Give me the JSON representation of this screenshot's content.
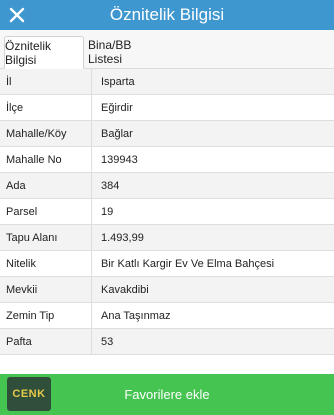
{
  "header": {
    "title": "Öznitelik Bilgisi",
    "close_icon": "close-icon"
  },
  "tabs": [
    {
      "label": "Öznitelik Bilgisi",
      "active": true
    },
    {
      "label": "Bina/BB Listesi",
      "active": false
    }
  ],
  "rows": [
    {
      "label": "İl",
      "value": "Isparta"
    },
    {
      "label": "İlçe",
      "value": "Eğirdir"
    },
    {
      "label": "Mahalle/Köy",
      "value": "Bağlar"
    },
    {
      "label": "Mahalle No",
      "value": "139943"
    },
    {
      "label": "Ada",
      "value": "384"
    },
    {
      "label": "Parsel",
      "value": "19"
    },
    {
      "label": "Tapu Alanı",
      "value": "1.493,99"
    },
    {
      "label": "Nitelik",
      "value": "Bir Katlı Kargir Ev Ve Elma Bahçesi"
    },
    {
      "label": "Mevkii",
      "value": "Kavakdibi"
    },
    {
      "label": "Zemin Tip",
      "value": "Ana Taşınmaz"
    },
    {
      "label": "Pafta",
      "value": "53"
    }
  ],
  "footer": {
    "favorite_label": "Favorilere ekle",
    "logo_text": "CENK"
  },
  "colors": {
    "header": "#3f97d0",
    "footer": "#45c451"
  }
}
